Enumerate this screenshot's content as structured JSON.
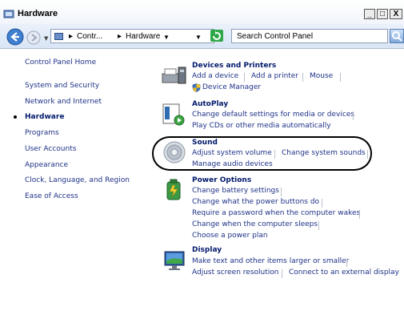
{
  "window": {
    "title": "Hardware",
    "minimize": "_",
    "maximize": "□",
    "close": "X"
  },
  "address": {
    "breadcrumb_1": "Contr...",
    "breadcrumb_2": "Hardware",
    "search_placeholder": "Search Control Panel"
  },
  "left_nav": {
    "items": [
      "Control Panel Home",
      "System and Security",
      "Network and Internet",
      "Hardware",
      "Programs",
      "User Accounts",
      "Appearance",
      "Clock, Language, and Region",
      "Ease of Access"
    ],
    "current": "Hardware"
  },
  "categories": {
    "devices": {
      "title": "Devices and Printers",
      "tasks": [
        "Add a device",
        "Add a printer",
        "Mouse",
        "Device Manager"
      ]
    },
    "autoplay": {
      "title": "AutoPlay",
      "tasks": [
        "Change default settings for media or devices",
        "Play CDs or other media automatically"
      ]
    },
    "sound": {
      "title": "Sound",
      "tasks": [
        "Adjust system volume",
        "Change system sounds",
        "Manage audio devices"
      ]
    },
    "power": {
      "title": "Power Options",
      "tasks": [
        "Change battery settings",
        "Change what the power buttons do",
        "Require a password when the computer wakes",
        "Change when the computer sleeps",
        "Choose a power plan"
      ]
    },
    "display": {
      "title": "Display",
      "tasks": [
        "Make text and other items larger or smaller",
        "Adjust screen resolution",
        "Connect to an external display"
      ]
    }
  },
  "colors": {
    "link": "#1e3287",
    "heading": "#00186b",
    "highlight": "#000000"
  }
}
